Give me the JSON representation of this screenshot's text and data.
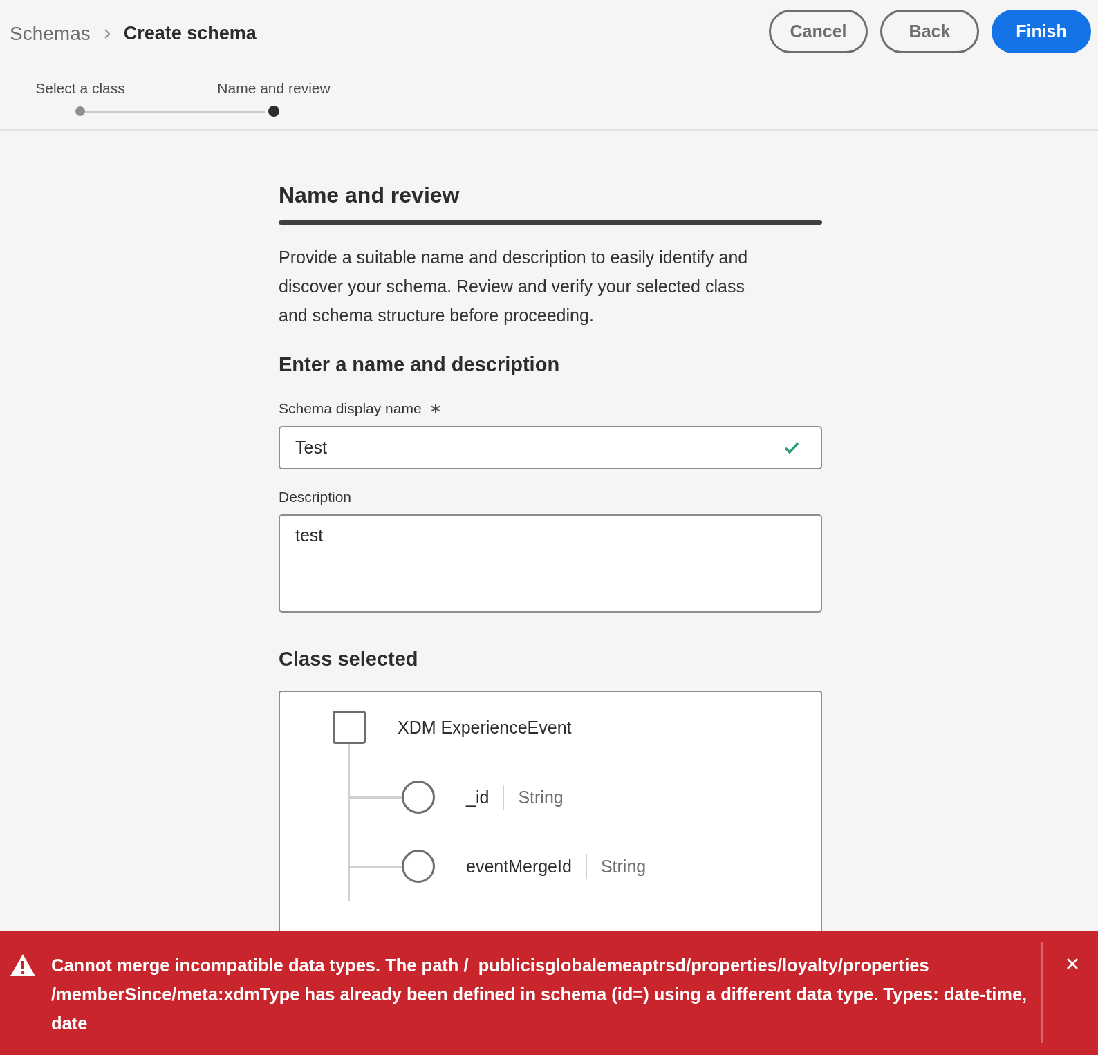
{
  "breadcrumb": [
    {
      "label": "Schemas",
      "current": false
    },
    {
      "label": "Create schema",
      "current": true
    }
  ],
  "actions": [
    {
      "label": "Cancel",
      "kind": "secondary"
    },
    {
      "label": "Back",
      "kind": "secondary"
    },
    {
      "label": "Finish",
      "kind": "primary"
    }
  ],
  "steps": [
    {
      "label": "Select a class",
      "selected": false
    },
    {
      "label": "Name and review",
      "selected": true
    }
  ],
  "section": {
    "title": "Name and review",
    "intro": "Provide a suitable name and description to easily identify and discover your schema. Review and verify your selected class and schema structure before proceeding.",
    "subtitle": "Enter a name and description",
    "fields": [
      {
        "kind": "input",
        "label": "Schema display name",
        "required": true,
        "value": "Test",
        "valid": true
      },
      {
        "kind": "textarea",
        "label": "Description",
        "required": false,
        "value": "test",
        "valid": false
      }
    ]
  },
  "class_selected": {
    "title": "Class selected",
    "root": {
      "name": "XDM ExperienceEvent",
      "checked": false,
      "children": [
        {
          "name": "_id",
          "type": "String",
          "selected": false
        },
        {
          "name": "eventMergeId",
          "type": "String",
          "selected": false
        }
      ]
    }
  },
  "toast": {
    "kind": "error",
    "message": "Cannot merge incompatible data types. The path /_publicisglobalemeaptrsd/properties/loyalty/properties /memberSince/meta:xdmType has already been defined in schema (id=) using a different data type. Types: date-time, date"
  }
}
